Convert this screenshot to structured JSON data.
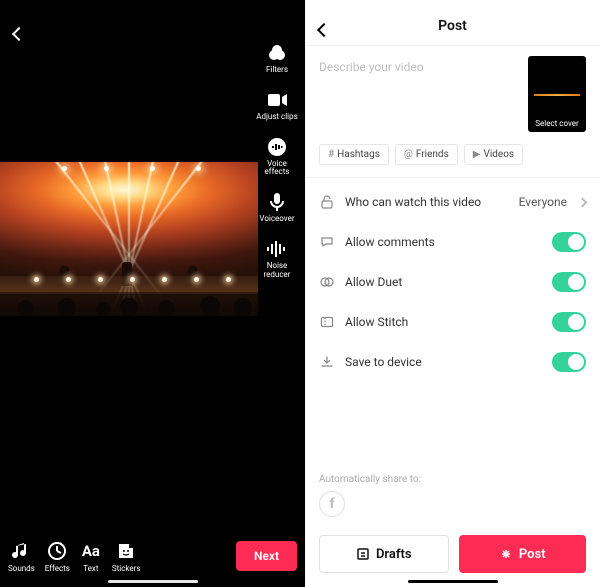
{
  "editor": {
    "side_tools": {
      "filters": "Filters",
      "adjust_clips": "Adjust clips",
      "voice_effects": "Voice\neffects",
      "voiceover": "Voiceover",
      "noise_reducer": "Noise\nreducer"
    },
    "bottom_tools": {
      "sounds": "Sounds",
      "effects": "Effects",
      "text": "Text",
      "stickers": "Stickers"
    },
    "next_button": "Next"
  },
  "post": {
    "header_title": "Post",
    "describe_placeholder": "Describe your video",
    "cover_label": "Select cover",
    "chips": {
      "hashtags": "Hashtags",
      "friends": "Friends",
      "videos": "Videos"
    },
    "settings": {
      "who_can_watch": {
        "label": "Who can watch this video",
        "value": "Everyone"
      },
      "allow_comments": {
        "label": "Allow comments",
        "on": true
      },
      "allow_duet": {
        "label": "Allow Duet",
        "on": true
      },
      "allow_stitch": {
        "label": "Allow Stitch",
        "on": true
      },
      "save_to_device": {
        "label": "Save to device",
        "on": true
      }
    },
    "share_label": "Automatically share to:",
    "drafts_button": "Drafts",
    "post_button": "Post"
  }
}
